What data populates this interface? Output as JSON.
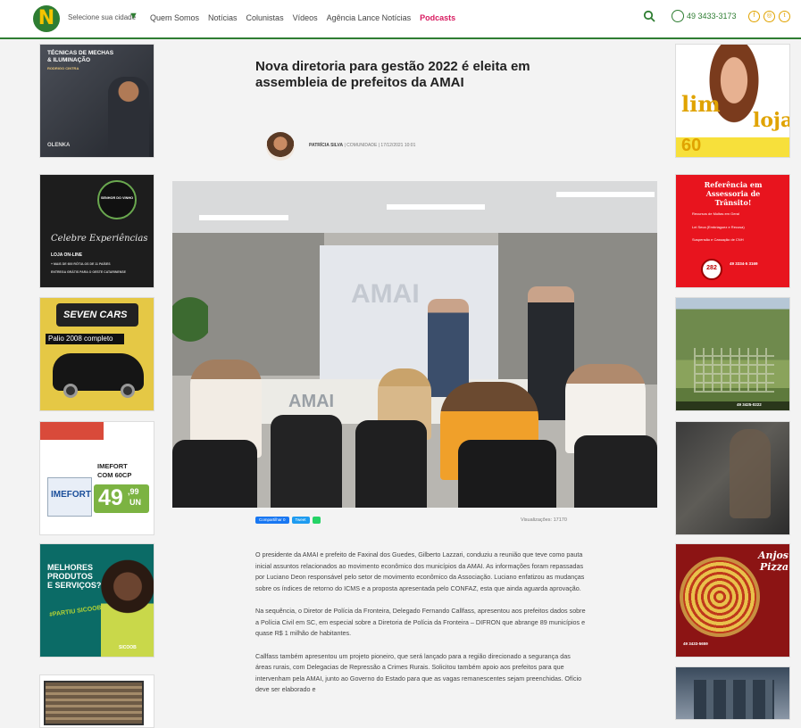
{
  "header": {
    "logo_letter": "N",
    "city_selector": "Selecione sua cidade",
    "nav": [
      "Quem Somos",
      "Notícias",
      "Colunistas",
      "Vídeos",
      "Agência Lance Notícias",
      "Podcasts"
    ],
    "phone": "49 3433-3173",
    "socials": [
      "f",
      "◎",
      "t"
    ],
    "accent": "#2e7d32",
    "podcast_color": "#d81b60"
  },
  "ads_left": [
    {
      "name": "ad-tecnicas",
      "line1": "TÉCNICAS DE MECHAS",
      "line2": "& ILUMINAÇÃO",
      "sub": "RODRIGO CINTRA",
      "brand": "OLENKA"
    },
    {
      "name": "ad-vinho",
      "brand": "SENHOR DO VINHO",
      "script": "Celebre Experiências",
      "line1": "LOJA ON-LINE",
      "line2": "+ MAIS DE 600 RÓTULOS DE 11 PAÍSES",
      "line3": "ENTREGA GRÁTIS PARA O OESTE CATARINENSE"
    },
    {
      "name": "ad-seven-cars",
      "brand": "SEVEN CARS",
      "caption": "Palio 2008 completo"
    },
    {
      "name": "ad-imefort",
      "product": "IMEFORT",
      "detail": "COM 60CP",
      "price_int": "49",
      "price_dec": ",99",
      "unit": "UN",
      "box": "IMEFORT"
    },
    {
      "name": "ad-sicoob",
      "line1": "MELHORES",
      "line2": "PRODUTOS",
      "line3": "E SERVIÇOS?",
      "tag": "#PARTIU SICOOB",
      "brand": "SICOOB"
    }
  ],
  "ads_right": [
    {
      "name": "ad-lim-loja",
      "word1": "lim",
      "word2": "loja",
      "number": "60"
    },
    {
      "name": "ad-transito",
      "title": "Referência em Assessoria de Trânsito!",
      "items": [
        "Recursos de Multas em Geral",
        "Lei Seca (Embriaguez e Recusa)",
        "Suspensão e Cassação de CNH"
      ],
      "badge": "282",
      "phone": "49 3334-5 3169"
    },
    {
      "name": "ad-loteamento",
      "caption": "49 3425-0222"
    },
    {
      "name": "ad-pizza",
      "title": "Anjos Pizza",
      "phone": "49 3433-5659"
    }
  ],
  "article": {
    "title": "Nova diretoria para gestão 2022 é eleita em assembleia de prefeitos da AMAI",
    "author": "PATRÍCIA SILVA",
    "category": "COMUNIDADE",
    "date": "17/12/2021 10:01",
    "photo_wall_text": "AMAI",
    "photo_desk_text": "AMAI",
    "share_fb": "Compartilhar 0",
    "share_tw": "Tweet",
    "views_label": "Visualizações: 17170",
    "paragraphs": [
      "O presidente da AMAI e prefeito de Faxinal dos Guedes, Gilberto Lazzari, conduziu a reunião que teve como pauta inicial assuntos relacionados ao movimento econômico dos municípios da AMAI. As informações foram repassadas por Luciano Deon responsável pelo setor de movimento econômico da Associação. Luciano enfatizou as mudanças sobre os índices de retorno do ICMS e a proposta apresentada pelo CONFAZ, esta que ainda aguarda aprovação.",
      "Na sequência, o Diretor de Polícia da Fronteira, Delegado Fernando Callfass, apresentou aos prefeitos dados sobre a Polícia Civil em SC, em especial sobre a Diretoria de Polícia da Fronteira – DIFRON que abrange 89 municípios e quase R$ 1 milhão de habitantes.",
      "Callfass também apresentou um projeto pioneiro, que será lançado para a região direcionado a segurança das áreas rurais, com Delegacias de Repressão a Crimes Rurais. Solicitou também apoio aos prefeitos para que intervenham pela AMAI, junto ao Governo do Estado para que as vagas remanescentes sejam preenchidas. Ofício deve ser elaborado e"
    ]
  }
}
